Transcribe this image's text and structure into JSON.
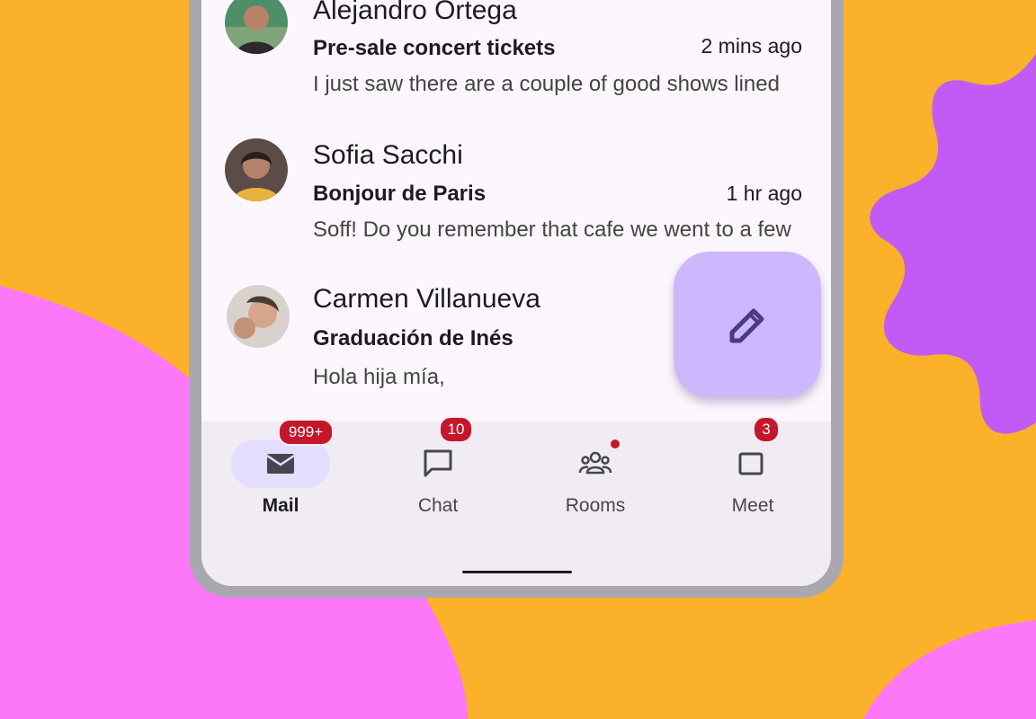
{
  "colors": {
    "background": "#FBB12A",
    "pink_blob": "#FC78F8",
    "purple_blob": "#C25BF5",
    "fab": "#CDB8FE",
    "badge": "#C5162B",
    "active_indicator": "#E3DEFD"
  },
  "emails": [
    {
      "sender": "Alejandro Ortega",
      "subject": "Pre-sale concert tickets",
      "time": "2 mins ago",
      "preview": "I just saw there are a couple of good shows lined"
    },
    {
      "sender": "Sofia Sacchi",
      "subject": "Bonjour de Paris",
      "time": "1 hr ago",
      "preview": "Soff! Do you remember that cafe we went to a few"
    },
    {
      "sender": "Carmen Villanueva",
      "subject": "Graduación de Inés",
      "time": "",
      "preview": "Hola hija mía,"
    }
  ],
  "fab": {
    "icon": "pencil-icon"
  },
  "nav": {
    "items": [
      {
        "label": "Mail",
        "icon": "mail-icon",
        "badge": "999+",
        "active": true
      },
      {
        "label": "Chat",
        "icon": "chat-icon",
        "badge": "10",
        "active": false
      },
      {
        "label": "Rooms",
        "icon": "rooms-icon",
        "badge": "",
        "active": false
      },
      {
        "label": "Meet",
        "icon": "meet-icon",
        "badge": "3",
        "active": false
      }
    ]
  }
}
